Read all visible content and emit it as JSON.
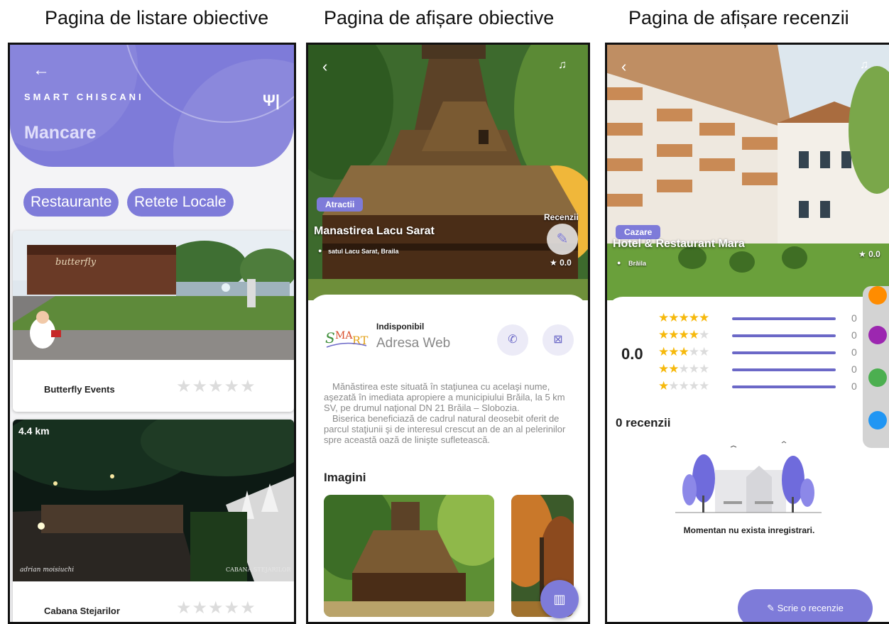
{
  "captions": {
    "listing": "Pagina de listare obiective",
    "detail": "Pagina de afișare obiective",
    "reviews": "Pagina de afișare recenzii"
  },
  "listing": {
    "app_name": "SMART CHISCANI",
    "category": "Mancare",
    "chips": [
      "Restaurante",
      "Retete Locale"
    ],
    "cards": [
      {
        "name": "Butterfly Events",
        "distance": ""
      },
      {
        "name": "Cabana Stejarilor",
        "distance": "4.4 km"
      }
    ],
    "stars": "★★★★★"
  },
  "detail": {
    "tag": "Atractii",
    "title": "Manastirea Lacu Sarat",
    "location": "satul Lacu Sarat, Braila",
    "reviews_label": "Recenzii",
    "rating": "★ 0.0",
    "status": "Indisponibil",
    "web": "Adresa Web",
    "description_1": "Mănăstirea este situată în staţiunea cu acelaşi nume, aşezată în imediata apropiere a municipiului Brăila, la 5 km SV, pe drumul naţional DN 21 Brăila – Slobozia.",
    "description_2": "Biserica beneficiază de cadrul natural deosebit oferit de parcul staţiunii şi de interesul crescut an de an al pelerinilor spre această oază de linişte sufletească.",
    "images_title": "Imagini"
  },
  "reviews": {
    "tag": "Cazare",
    "title": "Hotel & Restaurant Mara",
    "location": "Brăila",
    "rating_badge": "★ 0.0",
    "average": "0.0",
    "rows": [
      {
        "stars": 5,
        "count": "0"
      },
      {
        "stars": 4,
        "count": "0"
      },
      {
        "stars": 3,
        "count": "0"
      },
      {
        "stars": 2,
        "count": "0"
      },
      {
        "stars": 1,
        "count": "0"
      }
    ],
    "review_count": "0 recenzii",
    "empty_message": "Momentan nu exista inregistrari.",
    "write_button": "Scrie o recenzie",
    "palette": [
      "#ff8c00",
      "#9c27b0",
      "#4caf50",
      "#2196f3"
    ]
  },
  "colors": {
    "accent": "#7e7bd9",
    "star": "#f6b90d"
  }
}
